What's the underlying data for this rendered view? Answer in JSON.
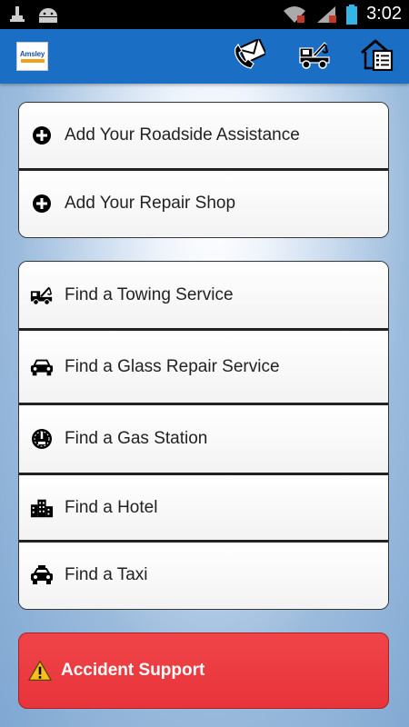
{
  "status_bar": {
    "time": "3:02",
    "icons": [
      "usb-debug-icon",
      "android-icon",
      "wifi-icon",
      "signal-icon",
      "battery-icon"
    ]
  },
  "action_bar": {
    "logo_text": "Amsley",
    "actions": [
      {
        "name": "call-contact-icon"
      },
      {
        "name": "tow-truck-icon"
      },
      {
        "name": "home-list-icon"
      }
    ]
  },
  "group_add": {
    "items": [
      {
        "label": "Add Your Roadside Assistance",
        "icon": "plus-circle-icon"
      },
      {
        "label": "Add Your Repair Shop",
        "icon": "plus-circle-icon"
      }
    ]
  },
  "group_find": {
    "items": [
      {
        "label": "Find a Towing Service",
        "icon": "tow-truck-icon"
      },
      {
        "label": "Find a Glass Repair Service",
        "icon": "car-icon"
      },
      {
        "label": "Find a Gas Station",
        "icon": "gauge-icon"
      },
      {
        "label": "Find a Hotel",
        "icon": "buildings-icon"
      },
      {
        "label": "Find a Taxi",
        "icon": "taxi-icon"
      }
    ]
  },
  "accident": {
    "label": "Accident Support",
    "icon": "warning-icon",
    "color": "#e8343a"
  },
  "colors": {
    "action_bar": "#1a6fc4",
    "status_bar": "#000000"
  }
}
